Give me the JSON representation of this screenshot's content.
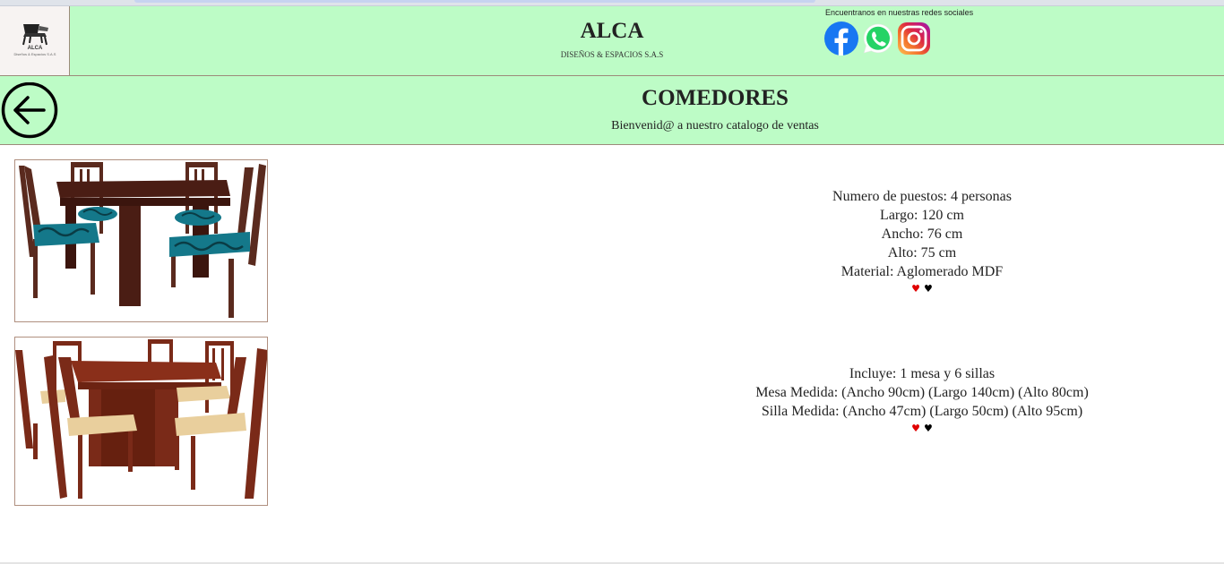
{
  "header": {
    "logo_name": "ALCA",
    "logo_tagline": "Diseños & Espacios S.A.S",
    "title": "ALCA",
    "subtitle": "DISEÑOS & ESPACIOS S.A.S",
    "social_caption": "Encuentranos en nuestras redes sociales",
    "social_icons": [
      "facebook-icon",
      "whatsapp-icon",
      "instagram-icon"
    ]
  },
  "section": {
    "back_icon": "arrow-left-icon",
    "title": "COMEDORES",
    "subtitle": "Bienvenid@ a nuestro catalogo de ventas"
  },
  "products": [
    {
      "lines": [
        "Numero de puestos: 4 personas",
        "Largo: 120 cm",
        "Ancho: 76 cm",
        "Alto: 75 cm",
        "Material: Aglomerado MDF"
      ],
      "hearts": [
        "♥",
        "♥"
      ]
    },
    {
      "lines": [
        "Incluye: 1 mesa y 6 sillas",
        "Mesa Medida: (Ancho 90cm) (Largo 140cm) (Alto 80cm)",
        "Silla Medida: (Ancho 47cm) (Largo 50cm) (Alto 95cm)"
      ],
      "hearts": [
        "♥",
        "♥"
      ]
    }
  ],
  "colors": {
    "header_bg": "#bdfcc6",
    "border": "#9c8a7a",
    "heart_red": "#e00000",
    "heart_black": "#000000"
  }
}
